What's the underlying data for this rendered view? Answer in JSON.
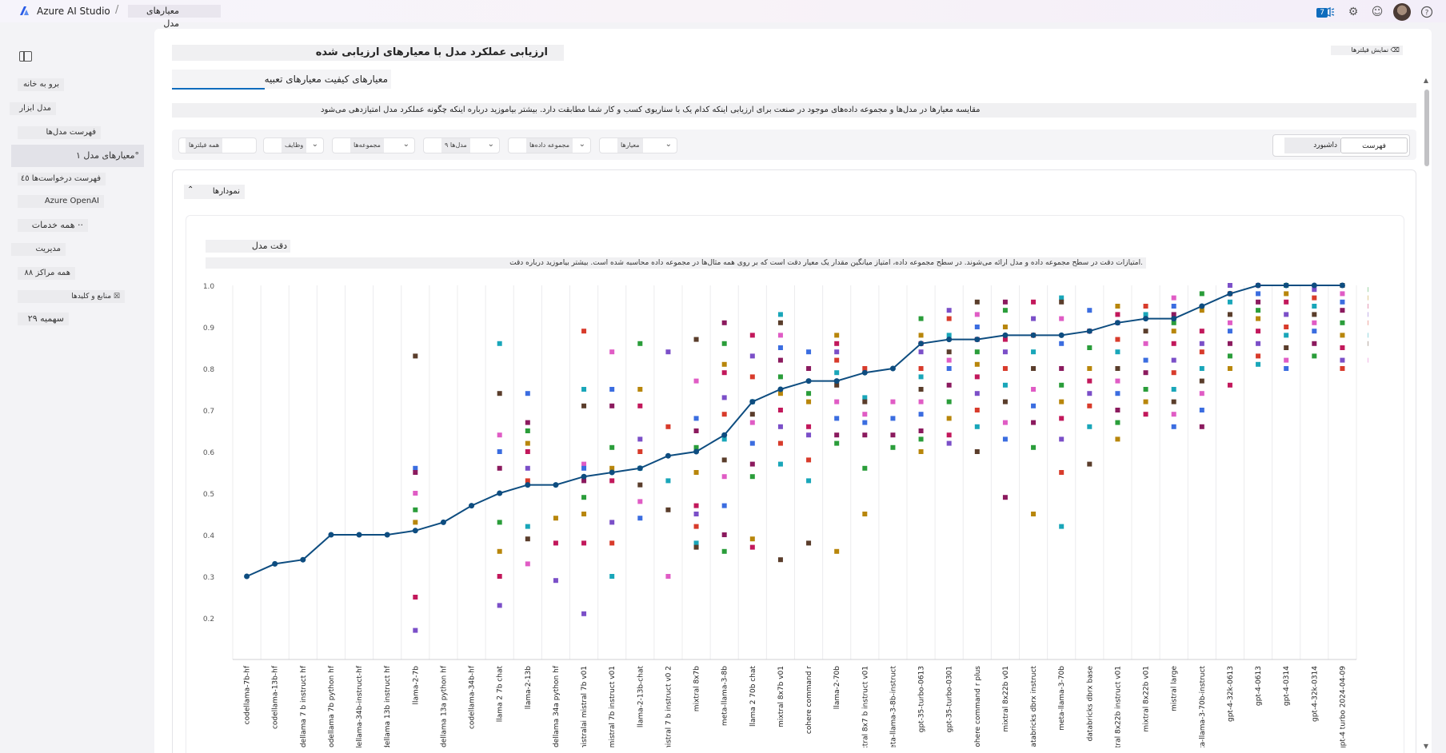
{
  "app": {
    "name": "Azure AI Studio",
    "breadcrumb": "معیارهای مدل",
    "notification_count": "7",
    "icons": [
      "megaphone-icon",
      "gear-icon",
      "smiley-icon",
      "avatar",
      "help-icon"
    ]
  },
  "sidebar": {
    "items": [
      {
        "label": "برو به خانه"
      },
      {
        "label": "مدل ابزار"
      },
      {
        "label": "فهرست مدل‌ها"
      },
      {
        "label": "معیارهای مدل ۱°",
        "active": true
      },
      {
        "label": "فهرست درخواست‌ها ٤٥"
      },
      {
        "label": "Azure OpenAI"
      },
      {
        "label": "همه خدمات ··"
      },
      {
        "label": "مدیریت"
      },
      {
        "label": "همه مراکز ٨٨"
      },
      {
        "label": "منابع و کلیدها ☒"
      },
      {
        "label": "سهمیه ٢٩"
      }
    ]
  },
  "page": {
    "title": "ارزیابی عملکرد مدل با معیارهای ارزیابی شده",
    "pin_filters": "نمایش فیلترها ⌫",
    "tab": "معیارهای کیفیت معیارهای تعبیه",
    "description": "مقایسه معیارها در مدل‌ها و مجموعه داده‌های موجود در صنعت برای ارزیابی اینکه کدام یک با سناریوی کسب و کار شما مطابقت دارد. بیشتر بیاموزید درباره اینکه چگونه عملکرد مدل امتیازدهی می‌شود"
  },
  "filters": {
    "items": [
      "همه فیلترها",
      "وظایف",
      "مجموعه‌ها",
      "مدل‌ها ۹",
      "مجموعه داده‌ها",
      "معیارها"
    ],
    "view_options": [
      "فهرست",
      "داشبورد"
    ],
    "selected_view": "فهرست"
  },
  "charts_section": {
    "toggle_label": "نمودارها",
    "chart_title": "دقت مدل",
    "chart_subtitle": "امتیازات دقت در سطح مجموعه داده و مدل ارائه می‌شوند. در سطح مجموعه داده، امتیاز میانگین مقدار یک معیار دقت است که بر روی همه مثال‌ها در مجموعه داده محاسبه شده است. بیشتر بیاموزید درباره دقت."
  },
  "colors": {
    "line": "#0e4d80",
    "accent": "#0f6cbd",
    "palette": [
      "#3b6de0",
      "#8b1a5e",
      "#2a9d3a",
      "#b8860b",
      "#c2185b",
      "#7b4fc8",
      "#d83b2b",
      "#19a6b9",
      "#5a3d2b",
      "#e05cc5"
    ]
  },
  "chart_data": {
    "type": "line",
    "title": "دقت مدل",
    "ylabel": "",
    "ylim": [
      0.1,
      1.0
    ],
    "y_ticks": [
      1.0,
      0.9,
      0.8,
      0.7,
      0.6,
      0.5,
      0.4,
      0.3,
      0.2
    ],
    "categories": [
      "codellama-7b-hf",
      "codellama-13b-hf",
      "codellama 7 b instruct hf",
      "codellama 7b python hf",
      "codellama-34b-instruct-hf",
      "codellama 13b instruct hf",
      "llama-2-7b",
      "codellama 13a python hf",
      "codellama-34b-hf",
      "llama 2 7b chat",
      "llama-2-13b",
      "codellama 34a python hf",
      "mistralai mistral 7b v01",
      "mistral 7b instruct v01",
      "llama-2-13b-chat",
      "mistral 7 b instruct v0 2",
      "mixtral 8x7b",
      "meta-llama-3-8b",
      "llama 2 70b chat",
      "mixtral 8x7b v01",
      "cohere command r",
      "llama-2-70b",
      "mixtral 8x7 b instruct v01",
      "meta-llama-3-8b-instruct",
      "gpt-35-turbo-0613",
      "gpt-35-turbo-0301",
      "cohere command r plus",
      "mixtral 8x22b v01",
      "databricks dbrx instruct",
      "meta-llama-3-70b",
      "databricks dbrx base",
      "mixtral 8x22b instruct v01",
      "mixtral 8x22b v01",
      "mistral large",
      "meta-llama-3-70b-instruct",
      "gpt-4-32k-0613",
      "gpt-4-0613",
      "gpt-4-0314",
      "gpt-4-32k-0314",
      "gpt-4 turbo 2024-04-09"
    ],
    "series": [
      {
        "values": [
          0.3,
          0.33,
          0.34,
          0.4,
          0.4,
          0.4,
          0.41,
          0.43,
          0.47,
          0.5,
          0.52,
          0.52,
          0.54,
          0.55,
          0.56,
          0.59,
          0.6,
          0.64,
          0.72,
          0.75,
          0.77,
          0.77,
          0.79,
          0.8,
          0.86,
          0.87,
          0.87,
          0.88,
          0.88,
          0.88,
          0.89,
          0.91,
          0.92,
          0.92,
          0.95,
          0.98,
          1.03,
          1.03,
          1.03,
          1.03,
          1.03,
          1.04
        ]
      }
    ],
    "scatter": [
      [],
      [],
      [],
      [],
      [],
      [],
      [
        0.83,
        0.5,
        0.56,
        0.55,
        0.46,
        0.43,
        0.25,
        0.17
      ],
      [],
      [],
      [
        0.86,
        0.74,
        0.64,
        0.6,
        0.56,
        0.43,
        0.36,
        0.3,
        0.23
      ],
      [
        0.74,
        0.67,
        0.65,
        0.62,
        0.6,
        0.56,
        0.53,
        0.42,
        0.39,
        0.33
      ],
      [
        0.44,
        0.38,
        0.29
      ],
      [
        0.89,
        0.75,
        0.71,
        0.57,
        0.56,
        0.53,
        0.49,
        0.45,
        0.38,
        0.21
      ],
      [
        0.84,
        0.75,
        0.71,
        0.61,
        0.56,
        0.53,
        0.43,
        0.38,
        0.3
      ],
      [
        0.86,
        0.75,
        0.71,
        0.63,
        0.6,
        0.56,
        0.52,
        0.48,
        0.44
      ],
      [
        0.84,
        0.66,
        0.53,
        0.46,
        0.3
      ],
      [
        0.87,
        0.77,
        0.68,
        0.65,
        0.61,
        0.55,
        0.47,
        0.45,
        0.42,
        0.38,
        0.37
      ],
      [
        0.91,
        0.86,
        0.81,
        0.79,
        0.73,
        0.69,
        0.63,
        0.58,
        0.54,
        0.47,
        0.4,
        0.36
      ],
      [
        0.88,
        0.83,
        0.78,
        0.72,
        0.69,
        0.67,
        0.62,
        0.57,
        0.54,
        0.39,
        0.37
      ],
      [
        0.93,
        0.91,
        0.88,
        0.85,
        0.82,
        0.78,
        0.74,
        0.7,
        0.66,
        0.62,
        0.57,
        0.34
      ],
      [
        0.84,
        0.8,
        0.74,
        0.72,
        0.66,
        0.64,
        0.58,
        0.53,
        0.38
      ],
      [
        0.88,
        0.86,
        0.84,
        0.82,
        0.79,
        0.76,
        0.72,
        0.68,
        0.64,
        0.62,
        0.36
      ],
      [
        0.8,
        0.73,
        0.72,
        0.69,
        0.67,
        0.64,
        0.56,
        0.45
      ],
      [
        0.72,
        0.68,
        0.64,
        0.61
      ],
      [
        0.92,
        0.88,
        0.86,
        0.84,
        0.8,
        0.78,
        0.75,
        0.72,
        0.69,
        0.65,
        0.63,
        0.6
      ],
      [
        0.94,
        0.92,
        0.88,
        0.84,
        0.82,
        0.8,
        0.76,
        0.72,
        0.68,
        0.64,
        0.62
      ],
      [
        0.96,
        0.93,
        0.9,
        0.87,
        0.84,
        0.81,
        0.78,
        0.74,
        0.7,
        0.66,
        0.6
      ],
      [
        0.96,
        0.94,
        0.9,
        0.87,
        0.84,
        0.8,
        0.76,
        0.72,
        0.67,
        0.63,
        0.49
      ],
      [
        0.96,
        0.92,
        0.88,
        0.84,
        0.8,
        0.75,
        0.71,
        0.67,
        0.61,
        0.45
      ],
      [
        0.97,
        0.96,
        0.92,
        0.86,
        0.8,
        0.76,
        0.72,
        0.68,
        0.63,
        0.55,
        0.42
      ],
      [
        0.94,
        0.89,
        0.85,
        0.8,
        0.77,
        0.74,
        0.71,
        0.66,
        0.57
      ],
      [
        0.95,
        0.93,
        0.91,
        0.87,
        0.84,
        0.8,
        0.77,
        0.74,
        0.7,
        0.67,
        0.63
      ],
      [
        0.95,
        0.93,
        0.89,
        0.86,
        0.82,
        0.79,
        0.75,
        0.72,
        0.69
      ],
      [
        0.97,
        0.95,
        0.93,
        0.91,
        0.89,
        0.86,
        0.82,
        0.79,
        0.75,
        0.72,
        0.69,
        0.66
      ],
      [
        0.98,
        0.94,
        0.89,
        0.86,
        0.84,
        0.8,
        0.77,
        0.74,
        0.7,
        0.66
      ],
      [
        1.0,
        0.98,
        0.96,
        0.93,
        0.91,
        0.89,
        0.86,
        0.83,
        0.8,
        0.76
      ],
      [
        1.02,
        1.0,
        0.98,
        0.96,
        0.94,
        0.92,
        0.89,
        0.86,
        0.83,
        0.81
      ],
      [
        1.02,
        1.0,
        0.98,
        0.96,
        0.93,
        0.9,
        0.88,
        0.85,
        0.82,
        0.8
      ],
      [
        1.01,
        0.99,
        0.97,
        0.95,
        0.93,
        0.91,
        0.89,
        0.86,
        0.83
      ],
      [
        1.02,
        1.0,
        0.98,
        0.96,
        0.94,
        0.91,
        0.88,
        0.85,
        0.82,
        0.8
      ],
      [
        1.03,
        1.01,
        0.99,
        0.97,
        0.95,
        0.93,
        0.91,
        0.88,
        0.86,
        0.82
      ]
    ]
  }
}
